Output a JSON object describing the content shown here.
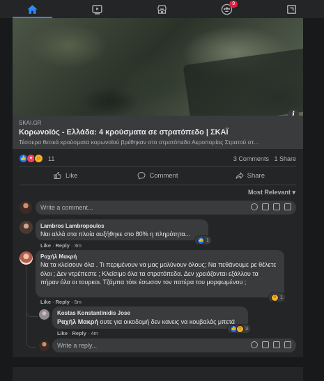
{
  "nav": {
    "items": [
      {
        "name": "home",
        "active": true
      },
      {
        "name": "watch",
        "active": false
      },
      {
        "name": "marketplace",
        "active": false
      },
      {
        "name": "groups",
        "active": false,
        "badge": "9"
      },
      {
        "name": "gaming",
        "active": false
      }
    ],
    "groups_badge": "9"
  },
  "post": {
    "link": {
      "domain": "SKAI.GR",
      "title": "Κορωνοϊός - Ελλάδα: 4 κρούσματα σε στρατόπεδο | ΣΚΑΪ",
      "description": "Τέσσερα θετικά κρούσματα κορωνοϊού βρέθηκαν στο στρατόπεδο Αεροπορίας Στρατού στ..."
    },
    "reactions": {
      "count": "11",
      "types": [
        "like",
        "love",
        "haha"
      ]
    },
    "stats": {
      "comments": "3 Comments",
      "shares": "1 Share"
    },
    "actions": {
      "like": "Like",
      "comment": "Comment",
      "share": "Share"
    },
    "sort": "Most Relevant"
  },
  "composer": {
    "placeholder": "Write a comment..."
  },
  "comments": [
    {
      "author": "Lambros Lambropoulos",
      "text": "Ναι αλλά στα πλοία αυξήθηκε στο 80% η πληρότητα...",
      "like": "Like",
      "reply": "Reply",
      "time": "3m",
      "reaction_count": "1"
    },
    {
      "author": "Ραχήλ Μακρή",
      "text": "Να τα κλείσουν όλα . Τι περιμένουν να μας μολύνουν όλους; Να πεθάνουμε ρε θέλετε όλοι ; Δεν ντρέπεστε ; Κλείσιμο όλα τα στρατόπεδα. Δεν χρειάζονται εξάλλου τα πήραν όλα οι τουρκοι. Τζάμπα τότε έσωσαν τον πατέρα του μορφωμένου ;",
      "like": "Like",
      "reply": "Reply",
      "time": "5m",
      "reaction_count": "1"
    }
  ],
  "reply_comment": {
    "author": "Kostas Konstantinidis Jose",
    "mention": "Ραχήλ Μακρή",
    "text": "ουτε για οικοδομή δεν κανεις να κουβαλάς μπετά",
    "like": "Like",
    "reply": "Reply",
    "time": "4m",
    "reaction_count": "3"
  },
  "reply_composer": {
    "placeholder": "Write a reply..."
  },
  "colors": {
    "accent": "#2d88ff",
    "badge": "#e41e3f",
    "background": "#18191a",
    "card": "#242526",
    "bubble": "#3a3b3c"
  }
}
